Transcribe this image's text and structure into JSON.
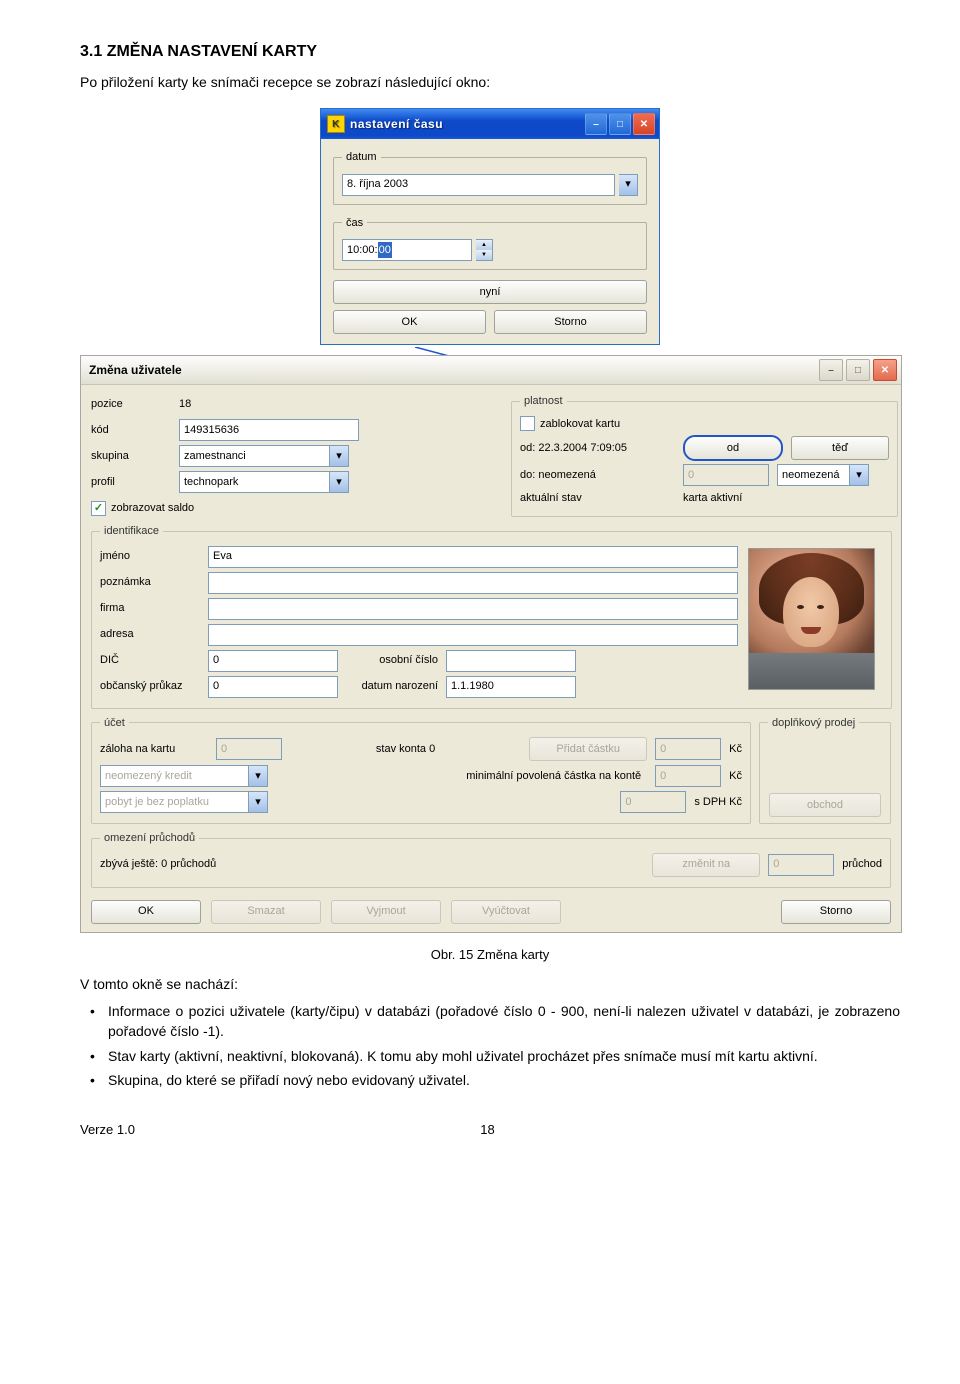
{
  "heading": "3.1   ZMĚNA NASTAVENÍ KARTY",
  "intro": "Po přiložení karty ke snímači recepce se zobrazí následující okno:",
  "popup": {
    "title": "nastavení času",
    "icon_letter": "K",
    "datum_legend": "datum",
    "date_value": "8.   října    2003",
    "cas_legend": "čas",
    "time_value_prefix": "10:00:",
    "time_value_sel": "00",
    "nyni_btn": "nyní",
    "ok_btn": "OK",
    "storno_btn": "Storno"
  },
  "large": {
    "title": "Změna uživatele",
    "labels": {
      "pozice": "pozice",
      "pozice_val": "18",
      "kod": "kód",
      "kod_val": "149315636",
      "skupina": "skupina",
      "skupina_val": "zamestnanci",
      "profil": "profil",
      "profil_val": "technopark",
      "zobrazovat": "zobrazovat saldo"
    },
    "platnost": {
      "legend": "platnost",
      "zablokovat": "zablokovat kartu",
      "od_label": "od: 22.3.2004 7:09:05",
      "od_btn": "od",
      "ted_btn": "těď",
      "do_label": "do: neomezená",
      "do_num": "0",
      "neomezena": "neomezená",
      "stav_label": "aktuální stav",
      "stav_val": "karta aktivní"
    },
    "ident": {
      "legend": "identifikace",
      "jmeno": "jméno",
      "jmeno_val": "Eva",
      "poznamka": "poznámka",
      "poznamka_val": "",
      "firma": "firma",
      "firma_val": "",
      "adresa": "adresa",
      "adresa_val": "",
      "dic": "DIČ",
      "dic_val": "0",
      "osobni": "osobní číslo",
      "osobni_val": "",
      "obcansky": "občanský průkaz",
      "obcansky_val": "0",
      "datumnar": "datum narození",
      "datumnar_val": "1.1.1980"
    },
    "ucet": {
      "legend": "účet",
      "zaloha": "záloha na kartu",
      "zaloha_val": "0",
      "stavkonta": "stav konta 0",
      "pridat": "Přidat částku",
      "pridat_val": "0",
      "kc1": "Kč",
      "kredit": "neomezený kredit",
      "minpovol": "minimální povolená částka na kontě",
      "minpovol_val": "0",
      "kc2": "Kč",
      "pobyt": "pobyt je bez poplatku",
      "dph_val": "0",
      "dph_label": "s DPH Kč"
    },
    "doplnkovy": {
      "legend": "doplňkový prodej",
      "obchod_btn": "obchod"
    },
    "omezeni": {
      "legend": "omezení průchodů",
      "zbyva": "zbývá ještě: 0 průchodů",
      "zmenit": "změnit na",
      "zmenit_val": "0",
      "pruchod": "průchod"
    },
    "bottom": {
      "ok": "OK",
      "smazat": "Smazat",
      "vyjmout": "Vyjmout",
      "vyuctovat": "Vyúčtovat",
      "storno": "Storno"
    }
  },
  "caption": "Obr. 15 Změna karty",
  "after_heading": "V tomto okně se nachází:",
  "bullets": [
    "Informace o pozici uživatele (karty/čipu) v databázi (pořadové číslo 0 - 900, není-li nalezen uživatel v databázi, je zobrazeno pořadové číslo -1).",
    "Stav karty (aktivní, neaktivní, blokovaná). K tomu aby mohl uživatel procházet přes snímače musí mít kartu aktivní.",
    "Skupina, do které se přiřadí nový nebo evidovaný uživatel."
  ],
  "footer": {
    "verze": "Verze 1.0",
    "page": "18"
  }
}
